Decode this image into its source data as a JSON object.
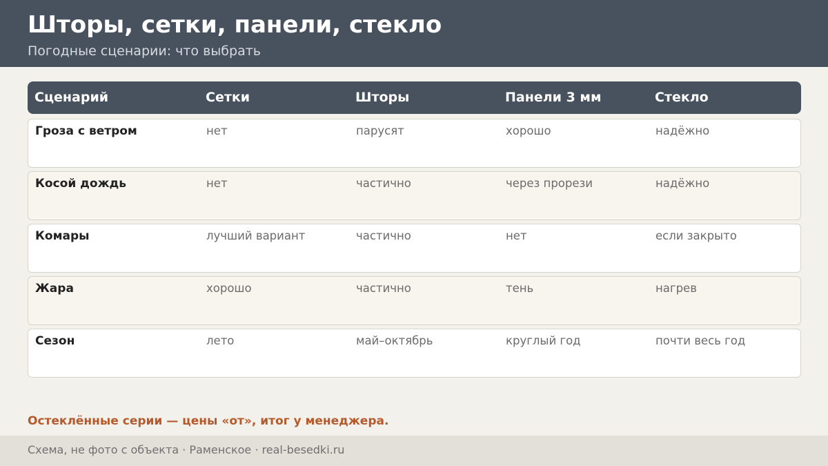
{
  "header": {
    "title": "Шторы, сетки, панели, стекло",
    "subtitle": "Погодные сценарии: что выбрать"
  },
  "table": {
    "columns": [
      "Сценарий",
      "Сетки",
      "Шторы",
      "Панели 3 мм",
      "Стекло"
    ],
    "rows": [
      [
        "Гроза с ветром",
        "нет",
        "парусят",
        "хорошо",
        "надёжно"
      ],
      [
        "Косой дождь",
        "нет",
        "частично",
        "через прорези",
        "надёжно"
      ],
      [
        "Комары",
        "лучший вариант",
        "частично",
        "нет",
        "если закрыто"
      ],
      [
        "Жара",
        "хорошо",
        "частично",
        "тень",
        "нагрев"
      ],
      [
        "Сезон",
        "лето",
        "май–октябрь",
        "круглый год",
        "почти весь год"
      ]
    ]
  },
  "note": "Остеклённые серии — цены «от», итог у менеджера.",
  "footer": "Схема, не фото с объекта  ·  Раменское  ·  real-besedki.ru",
  "colors": {
    "header_bg": "#48525e",
    "accent": "#b55a2c",
    "page_bg": "#f3f1ec"
  }
}
